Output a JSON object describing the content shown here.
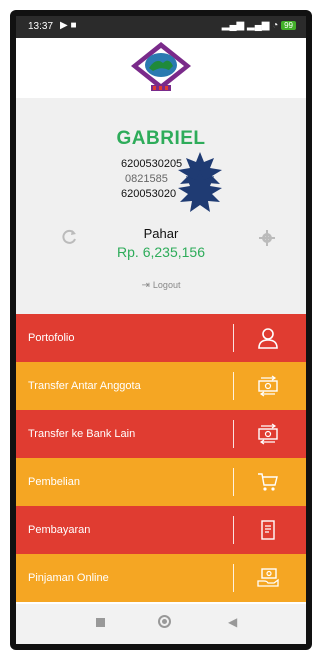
{
  "status_bar": {
    "time": "13:37",
    "battery": "99"
  },
  "profile": {
    "name": "GABRIEL",
    "line1": "6200530205",
    "line2": "0821585",
    "line3": "620053020",
    "branch": "Pahar",
    "balance": "Rp. 6,235,156",
    "logout": "Logout"
  },
  "menu": [
    {
      "label": "Portofolio",
      "icon": "user-icon",
      "color": "#e03c31"
    },
    {
      "label": "Transfer Antar Anggota",
      "icon": "money-transfer-icon",
      "color": "#f5a623"
    },
    {
      "label": "Transfer ke Bank Lain",
      "icon": "money-transfer-icon",
      "color": "#e03c31"
    },
    {
      "label": "Pembelian",
      "icon": "cart-icon",
      "color": "#f5a623"
    },
    {
      "label": "Pembayaran",
      "icon": "receipt-icon",
      "color": "#e03c31"
    },
    {
      "label": "Pinjaman Online",
      "icon": "cash-hand-icon",
      "color": "#f5a623"
    }
  ]
}
